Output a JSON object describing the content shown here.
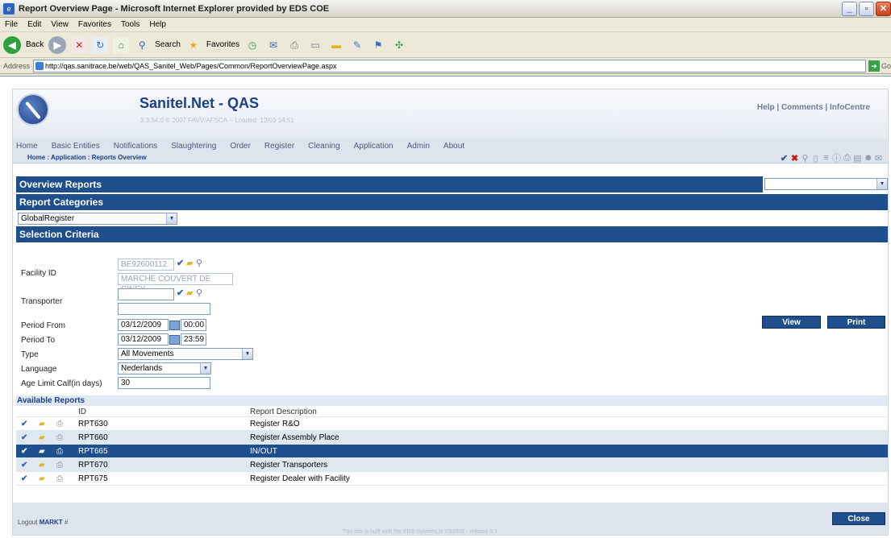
{
  "window": {
    "title": "Report Overview Page - Microsoft Internet Explorer provided by EDS COE",
    "menu": [
      "File",
      "Edit",
      "View",
      "Favorites",
      "Tools",
      "Help"
    ],
    "toolbar": {
      "back": "Back",
      "search": "Search",
      "favorites": "Favorites"
    },
    "address_label": "Address",
    "url": "http://qas.sanitrace.be/web/QAS_Sanitel_Web/Pages/Common/ReportOverviewPage.aspx",
    "go": "Go"
  },
  "app": {
    "title": "Sanitel.Net - QAS",
    "version": "3.3.54.0 © 2007 FAVV/AFSCA -- Loaded: 12/03 14:51",
    "help": "Help",
    "comments": "Comments",
    "infocentre": "InfoCentre",
    "nav": [
      "Home",
      "Basic Entities",
      "Notifications",
      "Slaughtering",
      "Order",
      "Register",
      "Cleaning",
      "Application",
      "Admin",
      "About"
    ],
    "breadcrumb": "Home : Application : Reports Overview"
  },
  "overview": {
    "title": "Overview Reports",
    "select_value": ""
  },
  "categories": {
    "title": "Report Categories",
    "selected": "GlobalRegister"
  },
  "criteria": {
    "title": "Selection Criteria",
    "facility_label": "Facility ID",
    "facility_id": "BE92600112",
    "facility_name": "MARCHE COUVERT DE CINEY",
    "transporter_label": "Transporter",
    "transporter_id": "",
    "transporter_name": "",
    "period_from_label": "Period From",
    "period_from_date": "03/12/2009",
    "period_from_time": "00:00",
    "period_to_label": "Period To",
    "period_to_date": "03/12/2009",
    "period_to_time": "23:59",
    "type_label": "Type",
    "type_value": "All Movements",
    "language_label": "Language",
    "language_value": "Nederlands",
    "age_label": "Age Limit Calf(in days)",
    "age_value": "30",
    "view_button": "View",
    "print_button": "Print"
  },
  "reports": {
    "title": "Available Reports",
    "col_id": "ID",
    "col_desc": "Report Description",
    "rows": [
      {
        "id": "RPT630",
        "desc": "Register R&O"
      },
      {
        "id": "RPT660",
        "desc": "Register Assembly Place"
      },
      {
        "id": "RPT665",
        "desc": "IN/OUT"
      },
      {
        "id": "RPT670",
        "desc": "Register Transporters"
      },
      {
        "id": "RPT675",
        "desc": "Register Dealer with Facility"
      }
    ]
  },
  "footer": {
    "logout": "Logout",
    "user": "MARKT",
    "close_button": "Close",
    "built_with": "This site is built with the EDS-SystemLib VS2005 - release 5.1"
  },
  "colors": {
    "brand": "#1e4f8c",
    "section_bar": "#1e4f8c",
    "row_alt": "#dde8f1"
  }
}
